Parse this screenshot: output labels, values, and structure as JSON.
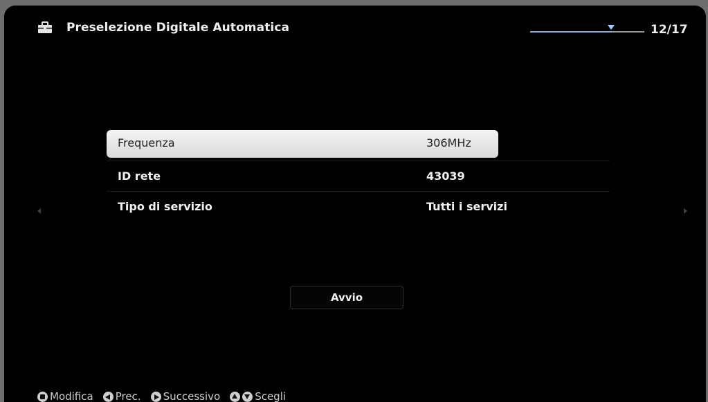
{
  "header": {
    "title": "Preselezione Digitale Automatica",
    "page_counter": "12/17",
    "step_progress": 0.71,
    "icon": "briefcase-icon"
  },
  "settings": [
    {
      "label": "Frequenza",
      "value": "306MHz",
      "selected": true
    },
    {
      "label": "ID rete",
      "value": "43039",
      "selected": false
    },
    {
      "label": "Tipo di servizio",
      "value": "Tutti i servizi",
      "selected": false
    }
  ],
  "start_button": {
    "label": "Avvio"
  },
  "footer": {
    "hints": [
      {
        "icon": "cross-pad-icon",
        "label": "Modifica"
      },
      {
        "icon": "left-button-icon",
        "label": "Prec."
      },
      {
        "icon": "right-button-icon",
        "label": "Successivo"
      },
      {
        "icon": "up-down-button-icon",
        "label": "Scegli"
      }
    ]
  },
  "colors": {
    "background": "#000000",
    "text": "#f0f0f0",
    "selected_row": "#e8e8e8",
    "progress": "#7fb0e0"
  }
}
